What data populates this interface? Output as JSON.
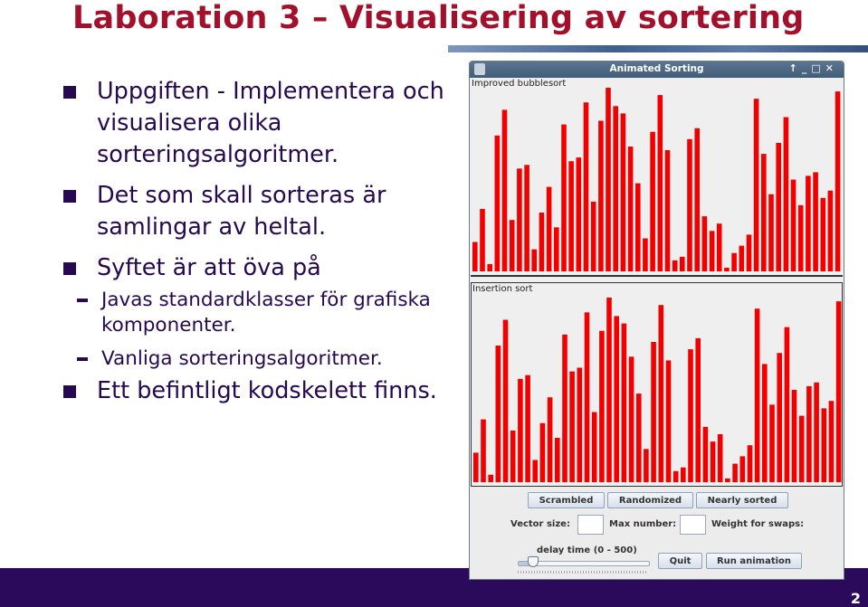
{
  "slide": {
    "title": "Laboration 3 – Visualisering av sortering",
    "bullets": [
      {
        "text": "Uppgiften - Implementera och visualisera olika sorteringsalgoritmer."
      },
      {
        "text": "Det som skall sorteras är samlingar av heltal."
      },
      {
        "text": "Syftet är att öva på",
        "sub": [
          "Javas standardklasser för grafiska komponenter.",
          "Vanliga sorteringsalgoritmer."
        ]
      },
      {
        "text": "Ett befintligt kodskelett finns."
      }
    ],
    "page_number": "2",
    "colors": {
      "title": "#a3102b",
      "text": "#26094f",
      "footer": "#2b0a5c",
      "bars": "#f20000"
    }
  },
  "window": {
    "title": "Animated Sorting",
    "controls_icons": [
      "up-arrow-icon",
      "minimize-icon",
      "maximize-icon",
      "close-icon"
    ],
    "panels": [
      {
        "label": "Improved bubblesort"
      },
      {
        "label": "Insertion sort"
      }
    ],
    "buttons": {
      "scrambled": "Scrambled",
      "randomized": "Randomized",
      "nearly_sorted": "Nearly sorted",
      "quit": "Quit",
      "run": "Run animation"
    },
    "fields": {
      "vector_size_label": "Vector size:",
      "vector_size_value": "",
      "max_number_label": "Max number:",
      "max_number_value": "",
      "weight_label": "Weight for swaps:"
    },
    "slider": {
      "label": "delay time (0 - 500)",
      "min": 0,
      "max": 500,
      "value": 60
    }
  },
  "chart_data": [
    {
      "type": "bar",
      "title": "Improved bubblesort",
      "ylim": [
        0,
        100
      ],
      "values": [
        16,
        34,
        4,
        74,
        88,
        28,
        56,
        58,
        12,
        32,
        46,
        24,
        80,
        60,
        62,
        92,
        38,
        82,
        100,
        90,
        86,
        68,
        48,
        18,
        76,
        96,
        66,
        6,
        8,
        72,
        78,
        30,
        22,
        26,
        2,
        10,
        14,
        20,
        94,
        64,
        42,
        70,
        84,
        50,
        36,
        52,
        54,
        40,
        44,
        98
      ]
    },
    {
      "type": "bar",
      "title": "Insertion sort",
      "ylim": [
        0,
        100
      ],
      "values": [
        16,
        34,
        4,
        74,
        88,
        28,
        56,
        58,
        12,
        32,
        46,
        24,
        80,
        60,
        62,
        92,
        38,
        82,
        100,
        90,
        86,
        68,
        48,
        18,
        76,
        96,
        66,
        6,
        8,
        72,
        78,
        30,
        22,
        26,
        2,
        10,
        14,
        20,
        94,
        64,
        42,
        70,
        84,
        50,
        36,
        52,
        54,
        40,
        44,
        98
      ]
    }
  ]
}
